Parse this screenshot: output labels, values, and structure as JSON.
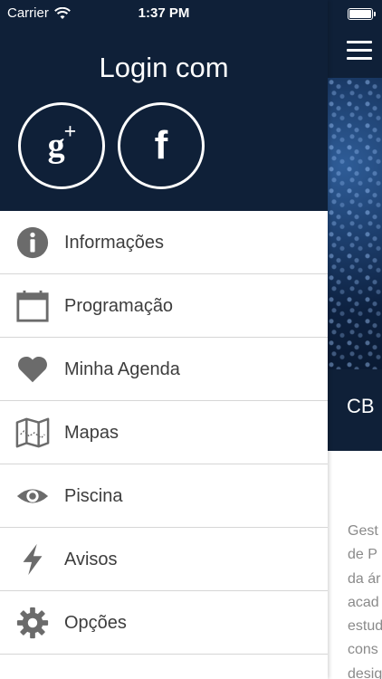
{
  "status_bar": {
    "carrier": "Carrier",
    "time": "1:37 PM"
  },
  "drawer": {
    "login_title": "Login com",
    "social": [
      {
        "name": "google-plus",
        "glyph": "g",
        "sup": "+"
      },
      {
        "name": "facebook",
        "glyph": "f"
      }
    ],
    "menu": [
      {
        "label": "Informações",
        "icon": "info-icon"
      },
      {
        "label": "Programação",
        "icon": "calendar-icon"
      },
      {
        "label": "Minha Agenda",
        "icon": "heart-icon"
      },
      {
        "label": "Mapas",
        "icon": "map-icon"
      },
      {
        "label": "Piscina",
        "icon": "eye-icon"
      },
      {
        "label": "Avisos",
        "icon": "lightning-icon"
      },
      {
        "label": "Opções",
        "icon": "gear-icon"
      }
    ]
  },
  "main": {
    "title": "CB",
    "body_lines": [
      "Gest",
      "de P",
      "da ár",
      "acad",
      "estud",
      "cons",
      "desig"
    ]
  },
  "colors": {
    "header_bg": "#0f2038",
    "icon": "#6b6b6b",
    "label": "#3d3d3d"
  }
}
